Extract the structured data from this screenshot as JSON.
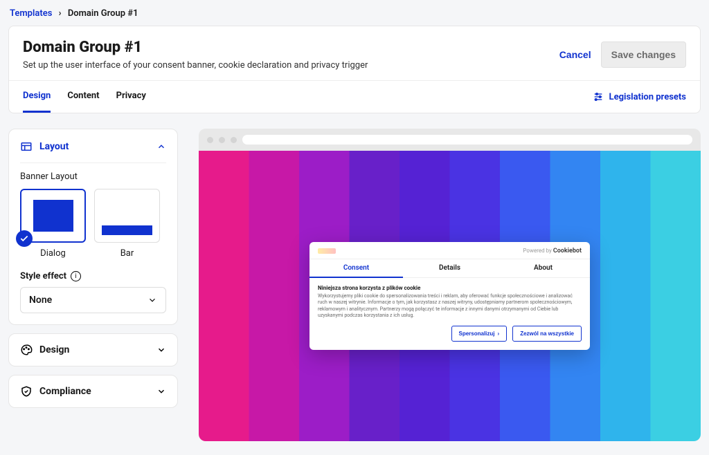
{
  "breadcrumb": {
    "parent": "Templates",
    "current": "Domain Group #1"
  },
  "header": {
    "title": "Domain Group #1",
    "subtitle": "Set up the user interface of your consent banner, cookie declaration and privacy trigger",
    "cancel": "Cancel",
    "save": "Save changes"
  },
  "tabs": {
    "design": "Design",
    "content": "Content",
    "privacy": "Privacy",
    "legislation": "Legislation presets"
  },
  "sidebar": {
    "layout": {
      "title": "Layout",
      "banner_label": "Banner Layout",
      "dialog_caption": "Dialog",
      "bar_caption": "Bar",
      "style_effect_label": "Style effect",
      "style_effect_value": "None"
    },
    "design_title": "Design",
    "compliance_title": "Compliance"
  },
  "consent_banner": {
    "powered_by": "Powered by",
    "brand": "Cookiebot",
    "tabs": {
      "consent": "Consent",
      "details": "Details",
      "about": "About"
    },
    "heading": "Niniejsza strona korzysta z plików cookie",
    "body": "Wykorzystujemy pliki cookie do spersonalizowania treści i reklam, aby oferować funkcje społecznościowe i analizować ruch w naszej witrynie. Informacje o tym, jak korzystasz z naszej witryny, udostępniamy partnerom społecznościowym, reklamowym i analitycznym. Partnerzy mogą połączyć te informacje z innymi danymi otrzymanymi od Ciebie lub uzyskanymi podczas korzystania z ich usług.",
    "btn_customize": "Spersonalizuj",
    "btn_allow_all": "Zezwól na wszystkie"
  }
}
